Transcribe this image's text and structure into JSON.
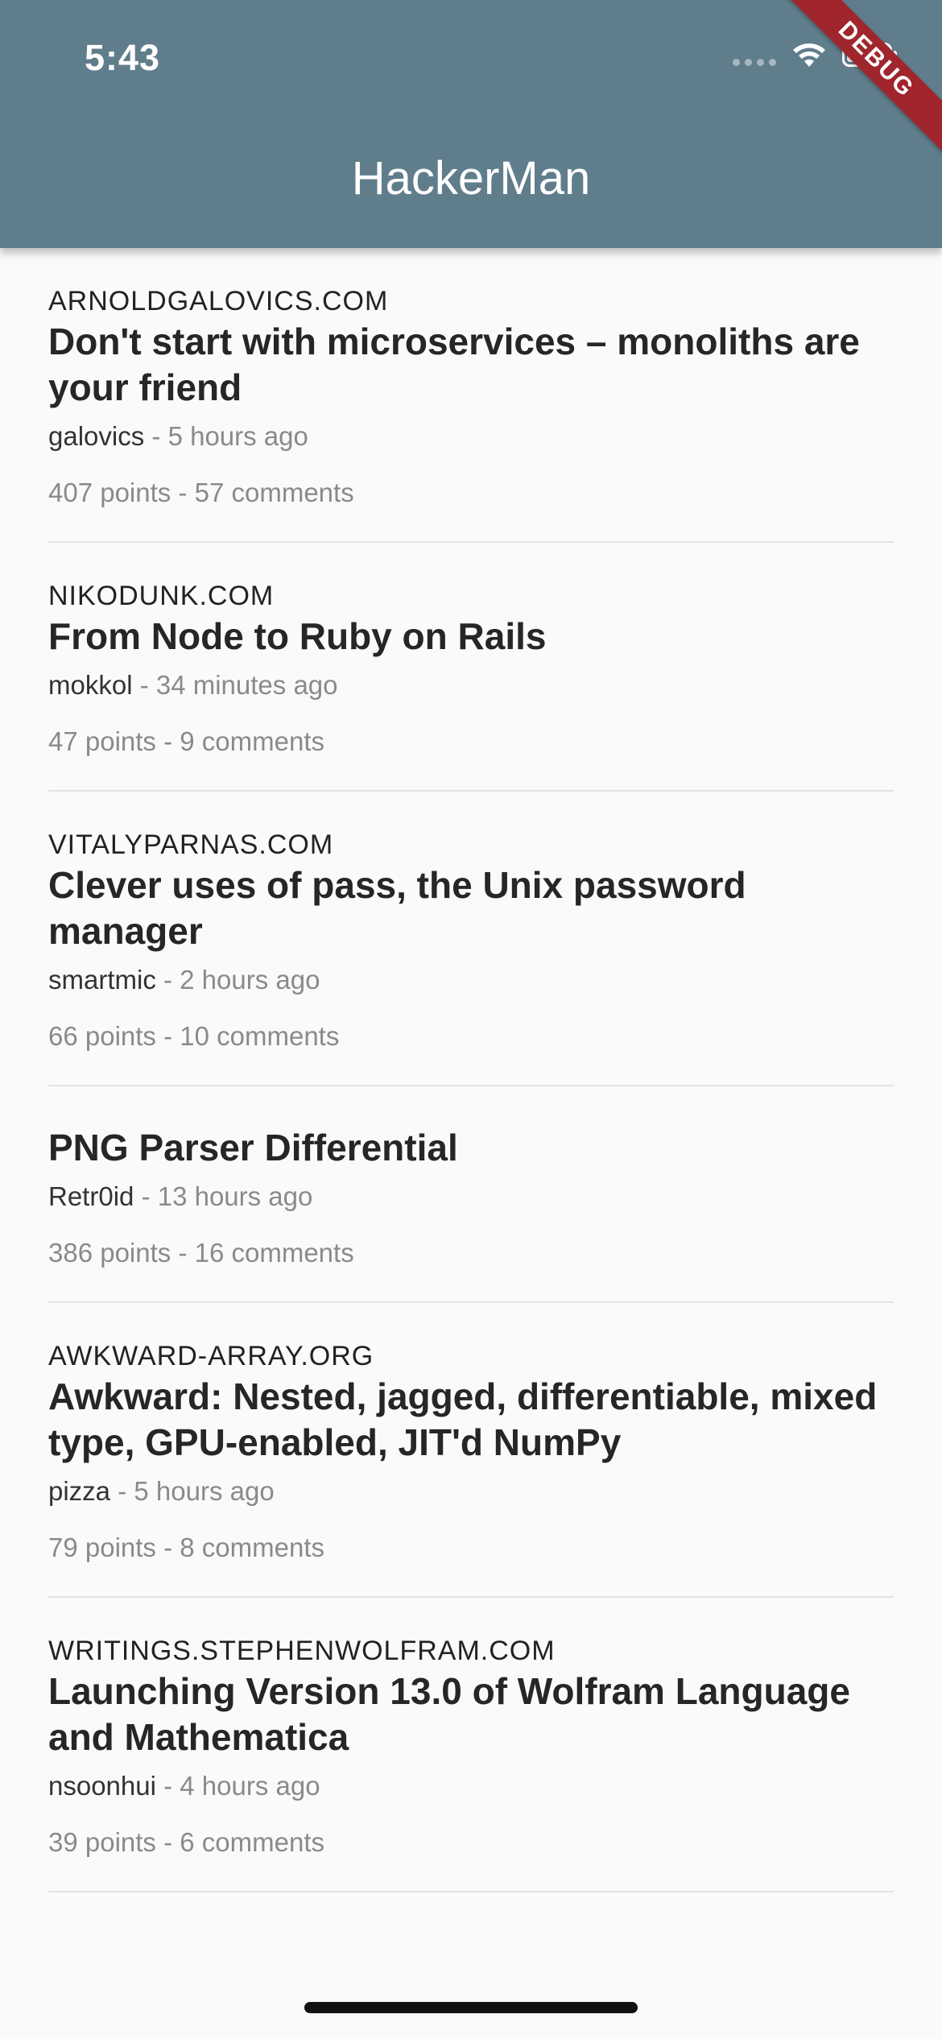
{
  "status_bar": {
    "time": "5:43"
  },
  "app_bar": {
    "title": "HackerMan",
    "color": "#607d8b"
  },
  "debug_banner": {
    "label": "DEBUG"
  },
  "stories": [
    {
      "domain": "ARNOLDGALOVICS.COM",
      "title": "Don't start with microservices – monoliths are your friend",
      "author": "galovics",
      "time": "- 5 hours ago",
      "stats": "407 points - 57 comments"
    },
    {
      "domain": "NIKODUNK.COM",
      "title": "From Node to Ruby on Rails",
      "author": "mokkol",
      "time": "- 34 minutes ago",
      "stats": "47 points - 9 comments"
    },
    {
      "domain": "VITALYPARNAS.COM",
      "title": "Clever uses of pass, the Unix password manager",
      "author": "smartmic",
      "time": "- 2 hours ago",
      "stats": "66 points - 10 comments"
    },
    {
      "domain": "",
      "title": "PNG Parser Differential",
      "author": "Retr0id",
      "time": "- 13 hours ago",
      "stats": "386 points - 16 comments"
    },
    {
      "domain": "AWKWARD-ARRAY.ORG",
      "title": "Awkward: Nested, jagged, differentiable, mixed type, GPU-enabled, JIT'd NumPy",
      "author": "pizza",
      "time": "- 5 hours ago",
      "stats": "79 points - 8 comments"
    },
    {
      "domain": "WRITINGS.STEPHENWOLFRAM.COM",
      "title": "Launching Version 13.0 of Wolfram Language and Mathematica",
      "author": "nsoonhui",
      "time": "- 4 hours ago",
      "stats": "39 points - 6 comments"
    }
  ]
}
